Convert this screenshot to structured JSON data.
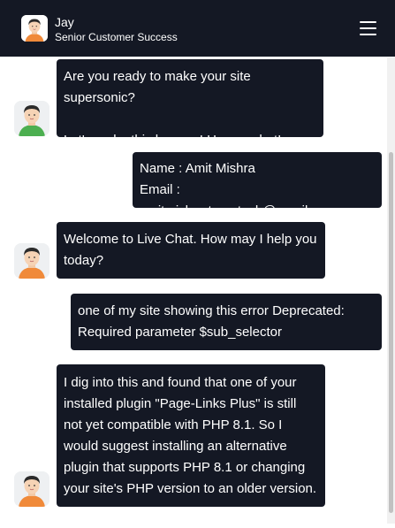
{
  "header": {
    "agent_name": "Jay",
    "agent_role": "Senior Customer Success",
    "avatar_icon": "agent-avatar-icon",
    "menu_icon": "hamburger-menu-icon"
  },
  "messages": [
    {
      "from": "agent",
      "lines": [
        "Are you ready to make your site supersonic?",
        "",
        "Let's make this happen! Have a chat!"
      ]
    },
    {
      "from": "user",
      "name_label": "Name : ",
      "name_value": "Amit Mishra",
      "email_label": "Email : ",
      "email_value": "amitmishra.tryootech@gmail.com"
    },
    {
      "from": "agent",
      "text": "Welcome to Live Chat. How may I help you today?"
    },
    {
      "from": "user",
      "text": "one of my site showing this error Deprecated: Required parameter $sub_selector"
    },
    {
      "from": "agent",
      "text": "I dig into this and found that one of your installed plugin \"Page-Links Plus\" is still not yet compatible with PHP 8.1. So I would suggest installing an alternative plugin that supports PHP 8.1 or changing your site's PHP version to an older version."
    }
  ],
  "colors": {
    "bubble_bg": "#141824",
    "header_bg": "#141824",
    "text": "#ffffff"
  }
}
